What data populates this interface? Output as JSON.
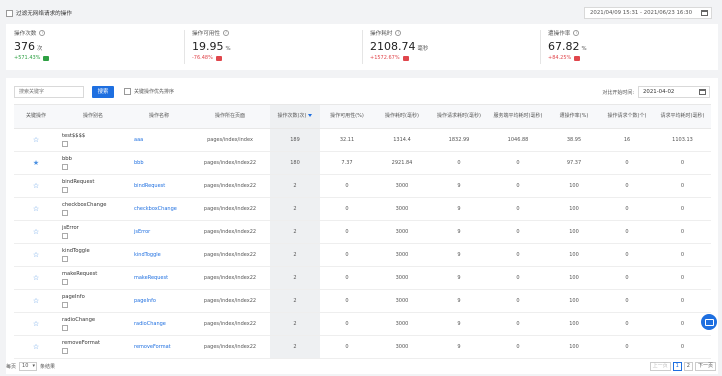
{
  "topbar": {
    "filter_label": "过滤无网络请求的操作",
    "date_range": "2021/04/09 15:31 - 2021/06/23 16:30"
  },
  "stats": [
    {
      "title": "操作次数",
      "value": "376",
      "unit": "次",
      "change": "+571.43%",
      "direction": "up"
    },
    {
      "title": "操作可用性",
      "value": "19.95",
      "unit": "%",
      "change": "-76.48%",
      "direction": "down"
    },
    {
      "title": "操作耗时",
      "value": "2108.74",
      "unit": "毫秒",
      "change": "+1572.67%",
      "direction": "down"
    },
    {
      "title": "遭操作率",
      "value": "67.82",
      "unit": "%",
      "change": "+84.25%",
      "direction": "down"
    }
  ],
  "toolbar": {
    "search_placeholder": "搜索关键字",
    "search_button": "搜索",
    "keyword_checkbox_label": "关键操作优先排序",
    "compare_label": "对比开始时间:",
    "compare_date": "2021-04-02"
  },
  "table": {
    "headers": [
      "关键操作",
      "操作别名",
      "操作名称",
      "操作所在页面",
      "操作次数(次)",
      "操作可用性(%)",
      "操作耗时(毫秒)",
      "操作请求耗时(毫秒)",
      "服务端平均耗时(毫秒)",
      "遭操作率(%)",
      "操作请求个数(个)",
      "请求平均耗时(毫秒)"
    ],
    "rows": [
      {
        "alias": "test$$$$",
        "name": "aaa",
        "page": "pages/index/index",
        "count": "189",
        "avail": "32.11",
        "cost": "1314.4",
        "req": "1832.99",
        "server": "1046.88",
        "fail": "38.95",
        "req_count": "16",
        "req_avg": "1103.13",
        "key": false
      },
      {
        "alias": "bbb",
        "name": "bbb",
        "page": "pages/index/index22",
        "count": "180",
        "avail": "7.37",
        "cost": "2921.84",
        "req": "0",
        "server": "0",
        "fail": "97.37",
        "req_count": "0",
        "req_avg": "0",
        "key": true
      },
      {
        "alias": "bindRequest",
        "name": "bindRequest",
        "page": "pages/index/index22",
        "count": "2",
        "avail": "0",
        "cost": "3000",
        "req": "9",
        "server": "0",
        "fail": "100",
        "req_count": "0",
        "req_avg": "0",
        "key": false
      },
      {
        "alias": "checkboxChange",
        "name": "checkboxChange",
        "page": "pages/index/index22",
        "count": "2",
        "avail": "0",
        "cost": "3000",
        "req": "9",
        "server": "0",
        "fail": "100",
        "req_count": "0",
        "req_avg": "0",
        "key": false
      },
      {
        "alias": "jsError",
        "name": "jsError",
        "page": "pages/index/index22",
        "count": "2",
        "avail": "0",
        "cost": "3000",
        "req": "9",
        "server": "0",
        "fail": "100",
        "req_count": "0",
        "req_avg": "0",
        "key": false
      },
      {
        "alias": "kindToggle",
        "name": "kindToggle",
        "page": "pages/index/index22",
        "count": "2",
        "avail": "0",
        "cost": "3000",
        "req": "9",
        "server": "0",
        "fail": "100",
        "req_count": "0",
        "req_avg": "0",
        "key": false
      },
      {
        "alias": "makeRequest",
        "name": "makeRequest",
        "page": "pages/index/index22",
        "count": "2",
        "avail": "0",
        "cost": "3000",
        "req": "9",
        "server": "0",
        "fail": "100",
        "req_count": "0",
        "req_avg": "0",
        "key": false
      },
      {
        "alias": "pageInfo",
        "name": "pageInfo",
        "page": "pages/index/index22",
        "count": "2",
        "avail": "0",
        "cost": "3000",
        "req": "9",
        "server": "0",
        "fail": "100",
        "req_count": "0",
        "req_avg": "0",
        "key": false
      },
      {
        "alias": "radioChange",
        "name": "radioChange",
        "page": "pages/index/index22",
        "count": "2",
        "avail": "0",
        "cost": "3000",
        "req": "9",
        "server": "0",
        "fail": "100",
        "req_count": "0",
        "req_avg": "0",
        "key": false
      },
      {
        "alias": "removeFormat",
        "name": "removeFormat",
        "page": "pages/index/index22",
        "count": "2",
        "avail": "0",
        "cost": "3000",
        "req": "9",
        "server": "0",
        "fail": "100",
        "req_count": "0",
        "req_avg": "0",
        "key": false
      }
    ]
  },
  "pager": {
    "prefix": "每页",
    "size": "10",
    "suffix": "条结果",
    "prev": "上一页",
    "pages": [
      "1",
      "2"
    ],
    "current": "1",
    "next": "下一页"
  },
  "colors": {
    "accent": "#1e6fe0",
    "up": "#2ea043",
    "down": "#e0464c"
  }
}
